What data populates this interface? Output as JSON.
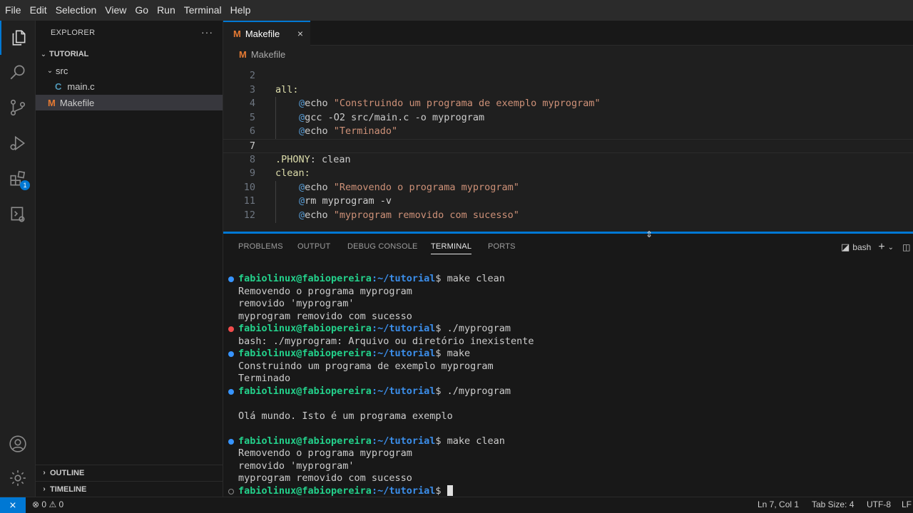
{
  "menu": [
    "File",
    "Edit",
    "Selection",
    "View",
    "Go",
    "Run",
    "Terminal",
    "Help"
  ],
  "activity": {
    "extensions_badge": "1"
  },
  "explorer": {
    "title": "EXPLORER",
    "more": "···",
    "root": "TUTORIAL",
    "folder": "src",
    "file_c": "main.c",
    "file_c_icon": "C",
    "file_make": "Makefile",
    "file_make_icon": "M",
    "outline": "OUTLINE",
    "timeline": "TIMELINE"
  },
  "editor": {
    "tab_label": "Makefile",
    "tab_icon": "M",
    "tab_close": "×",
    "breadcrumb": "Makefile",
    "line_numbers": [
      "2",
      "3",
      "4",
      "5",
      "6",
      "7",
      "8",
      "9",
      "10",
      "11",
      "12"
    ],
    "lines": [
      {
        "text": ""
      },
      {
        "target": "all:"
      },
      {
        "at": "@",
        "cmd": "echo ",
        "str": "\"Construindo um programa de exemplo myprogram\""
      },
      {
        "at": "@",
        "cmd": "gcc -O2 src/main.c -o myprogram"
      },
      {
        "at": "@",
        "cmd": "echo ",
        "str": "\"Terminado\""
      },
      {
        "text": ""
      },
      {
        "kw": ".PHONY",
        "rest": ": clean"
      },
      {
        "target": "clean:"
      },
      {
        "at": "@",
        "cmd": "echo ",
        "str": "\"Removendo o programa myprogram\""
      },
      {
        "at": "@",
        "cmd": "rm myprogram -v"
      },
      {
        "at": "@",
        "cmd": "echo ",
        "str": "\"myprogram removido com sucesso\""
      }
    ]
  },
  "panel": {
    "tabs": [
      "PROBLEMS",
      "OUTPUT",
      "DEBUG CONSOLE",
      "TERMINAL",
      "PORTS"
    ],
    "active_tab": "TERMINAL",
    "shell": "bash",
    "plus": "+",
    "terminal": [
      {
        "dot": "ok",
        "user": "fabiolinux@fabiopereira",
        "path": ":~/tutorial",
        "cmd": "$ make clean"
      },
      {
        "text": "Removendo o programa myprogram"
      },
      {
        "text": "removido 'myprogram'"
      },
      {
        "text": "myprogram removido com sucesso"
      },
      {
        "dot": "err",
        "user": "fabiolinux@fabiopereira",
        "path": ":~/tutorial",
        "cmd": "$ ./myprogram"
      },
      {
        "text": "bash: ./myprogram: Arquivo ou diretório inexistente"
      },
      {
        "dot": "ok",
        "user": "fabiolinux@fabiopereira",
        "path": ":~/tutorial",
        "cmd": "$ make"
      },
      {
        "text": "Construindo um programa de exemplo myprogram"
      },
      {
        "text": "Terminado"
      },
      {
        "dot": "ok",
        "user": "fabiolinux@fabiopereira",
        "path": ":~/tutorial",
        "cmd": "$ ./myprogram"
      },
      {
        "text": ""
      },
      {
        "text": "Olá mundo. Isto é um programa exemplo"
      },
      {
        "text": ""
      },
      {
        "dot": "ok",
        "user": "fabiolinux@fabiopereira",
        "path": ":~/tutorial",
        "cmd": "$ make clean"
      },
      {
        "text": "Removendo o programa myprogram"
      },
      {
        "text": "removido 'myprogram'"
      },
      {
        "text": "myprogram removido com sucesso"
      },
      {
        "dot": "idle",
        "user": "fabiolinux@fabiopereira",
        "path": ":~/tutorial",
        "cmd": "$ ",
        "cursor": true
      }
    ]
  },
  "status": {
    "errors": "0",
    "warnings": "0",
    "position": "Ln 7, Col 1",
    "tab_size": "Tab Size: 4",
    "encoding": "UTF-8",
    "eol": "LF"
  },
  "colors": {
    "accent": "#0078d4",
    "prompt_user": "#23d18b",
    "prompt_path": "#3b8eea",
    "makefile_icon": "#e37933",
    "c_icon": "#519aba"
  }
}
